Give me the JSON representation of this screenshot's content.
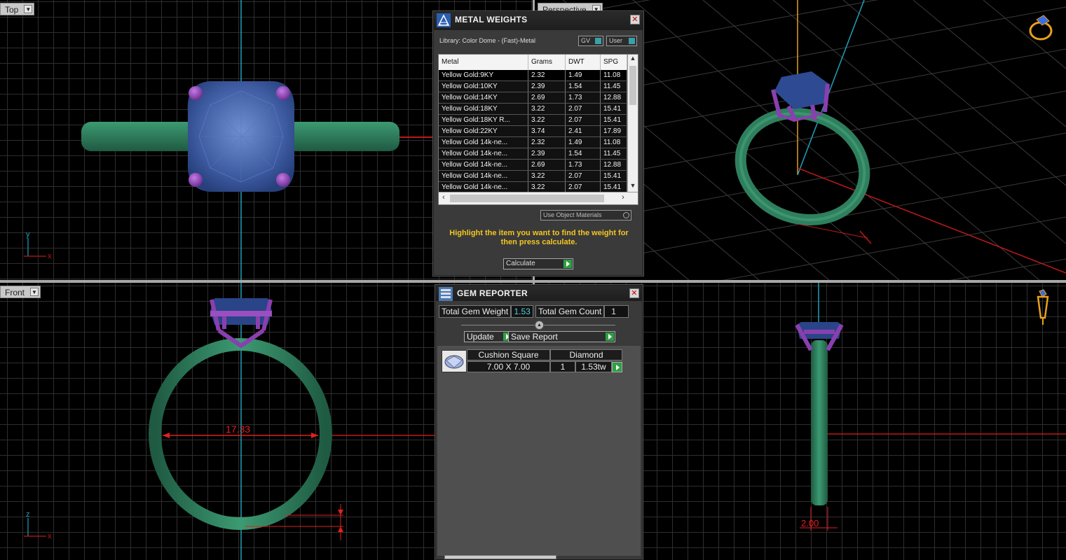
{
  "viewports": {
    "top": {
      "label": "Top",
      "axis_labels": [
        "y",
        "x"
      ]
    },
    "perspective": {
      "label": "Perspective"
    },
    "front": {
      "label": "Front",
      "axis_labels": [
        "z",
        "x"
      ],
      "dimension_inner": "17.33"
    },
    "right": {
      "dimension_width": "2.00"
    }
  },
  "metal_weights": {
    "title": "METAL WEIGHTS",
    "library": "Library: Color Dome - (Fast)-Metal",
    "btn_gv": "GV",
    "btn_user": "User",
    "columns": [
      "Metal",
      "Grams",
      "DWT",
      "SPG"
    ],
    "rows": [
      {
        "metal": "Yellow Gold:9KY",
        "grams": "2.32",
        "dwt": "1.49",
        "spg": "11.08"
      },
      {
        "metal": "Yellow Gold:10KY",
        "grams": "2.39",
        "dwt": "1.54",
        "spg": "11.45"
      },
      {
        "metal": "Yellow Gold:14KY",
        "grams": "2.69",
        "dwt": "1.73",
        "spg": "12.88"
      },
      {
        "metal": "Yellow Gold:18KY",
        "grams": "3.22",
        "dwt": "2.07",
        "spg": "15.41"
      },
      {
        "metal": "Yellow Gold:18KY R...",
        "grams": "3.22",
        "dwt": "2.07",
        "spg": "15.41"
      },
      {
        "metal": "Yellow Gold:22KY",
        "grams": "3.74",
        "dwt": "2.41",
        "spg": "17.89"
      },
      {
        "metal": "Yellow Gold 14k-ne...",
        "grams": "2.32",
        "dwt": "1.49",
        "spg": "11.08"
      },
      {
        "metal": "Yellow Gold 14k-ne...",
        "grams": "2.39",
        "dwt": "1.54",
        "spg": "11.45"
      },
      {
        "metal": "Yellow Gold 14k-ne...",
        "grams": "2.69",
        "dwt": "1.73",
        "spg": "12.88"
      },
      {
        "metal": "Yellow Gold 14k-ne...",
        "grams": "3.22",
        "dwt": "2.07",
        "spg": "15.41"
      },
      {
        "metal": "Yellow Gold 14k-ne...",
        "grams": "3.22",
        "dwt": "2.07",
        "spg": "15.41"
      }
    ],
    "use_object_materials": "Use Object Materials",
    "hint": "Highlight the item you want to find the weight for then press calculate.",
    "calculate_label": "Calculate"
  },
  "gem_reporter": {
    "title": "GEM REPORTER",
    "total_weight_label": "Total Gem Weight",
    "total_weight_value": "1.53",
    "total_count_label": "Total Gem Count",
    "total_count_value": "1",
    "update_label": "Update",
    "save_report_label": "Save Report",
    "gems": [
      {
        "shape": "Cushion Square",
        "material": "Diamond",
        "size": "7.00 X 7.00",
        "count": "1",
        "weight": "1.53tw"
      }
    ]
  },
  "colors": {
    "band": "#2f7f5e",
    "gem": "#3f5fa8",
    "prong": "#8a3fb0",
    "dimension": "#e02020",
    "axis_vertical": "#1fa0b8",
    "hint_text": "#f3c622"
  }
}
